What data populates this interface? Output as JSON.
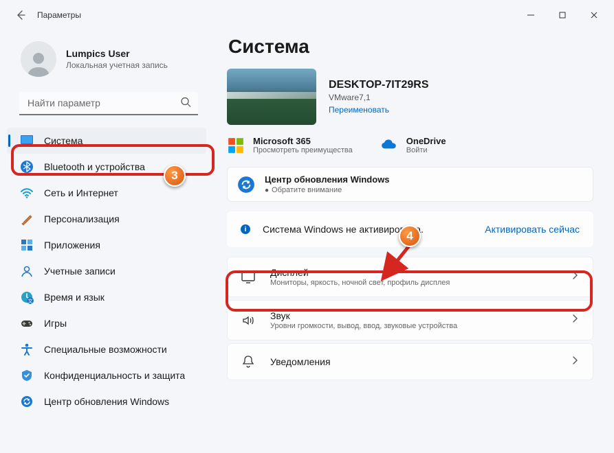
{
  "window": {
    "title": "Параметры"
  },
  "user": {
    "name": "Lumpics User",
    "subtitle": "Локальная учетная запись"
  },
  "search": {
    "placeholder": "Найти параметр"
  },
  "sidebar": {
    "items": [
      {
        "label": "Система",
        "icon": "system"
      },
      {
        "label": "Bluetooth и устройства",
        "icon": "bluetooth"
      },
      {
        "label": "Сеть и Интернет",
        "icon": "wifi"
      },
      {
        "label": "Персонализация",
        "icon": "brush"
      },
      {
        "label": "Приложения",
        "icon": "apps"
      },
      {
        "label": "Учетные записи",
        "icon": "account"
      },
      {
        "label": "Время и язык",
        "icon": "time"
      },
      {
        "label": "Игры",
        "icon": "games"
      },
      {
        "label": "Специальные возможности",
        "icon": "accessibility"
      },
      {
        "label": "Конфиденциальность и защита",
        "icon": "privacy"
      },
      {
        "label": "Центр обновления Windows",
        "icon": "update"
      }
    ]
  },
  "main": {
    "heading": "Система",
    "pc": {
      "name": "DESKTOP-7IT29RS",
      "model": "VMware7,1",
      "rename_label": "Переименовать"
    },
    "promos": [
      {
        "title": "Microsoft 365",
        "subtitle": "Просмотреть преимущества"
      },
      {
        "title": "OneDrive",
        "subtitle": "Войти"
      }
    ],
    "update": {
      "title": "Центр обновления Windows",
      "subtitle": "Обратите внимание"
    },
    "activation": {
      "text": "Система Windows не активирована.",
      "link": "Активировать сейчас"
    },
    "settings": [
      {
        "title": "Дисплей",
        "subtitle": "Мониторы, яркость, ночной свет, профиль дисплея"
      },
      {
        "title": "Звук",
        "subtitle": "Уровни громкости, вывод, ввод, звуковые устройства"
      },
      {
        "title": "Уведомления",
        "subtitle": ""
      }
    ]
  },
  "callouts": {
    "step3": "3",
    "step4": "4"
  }
}
